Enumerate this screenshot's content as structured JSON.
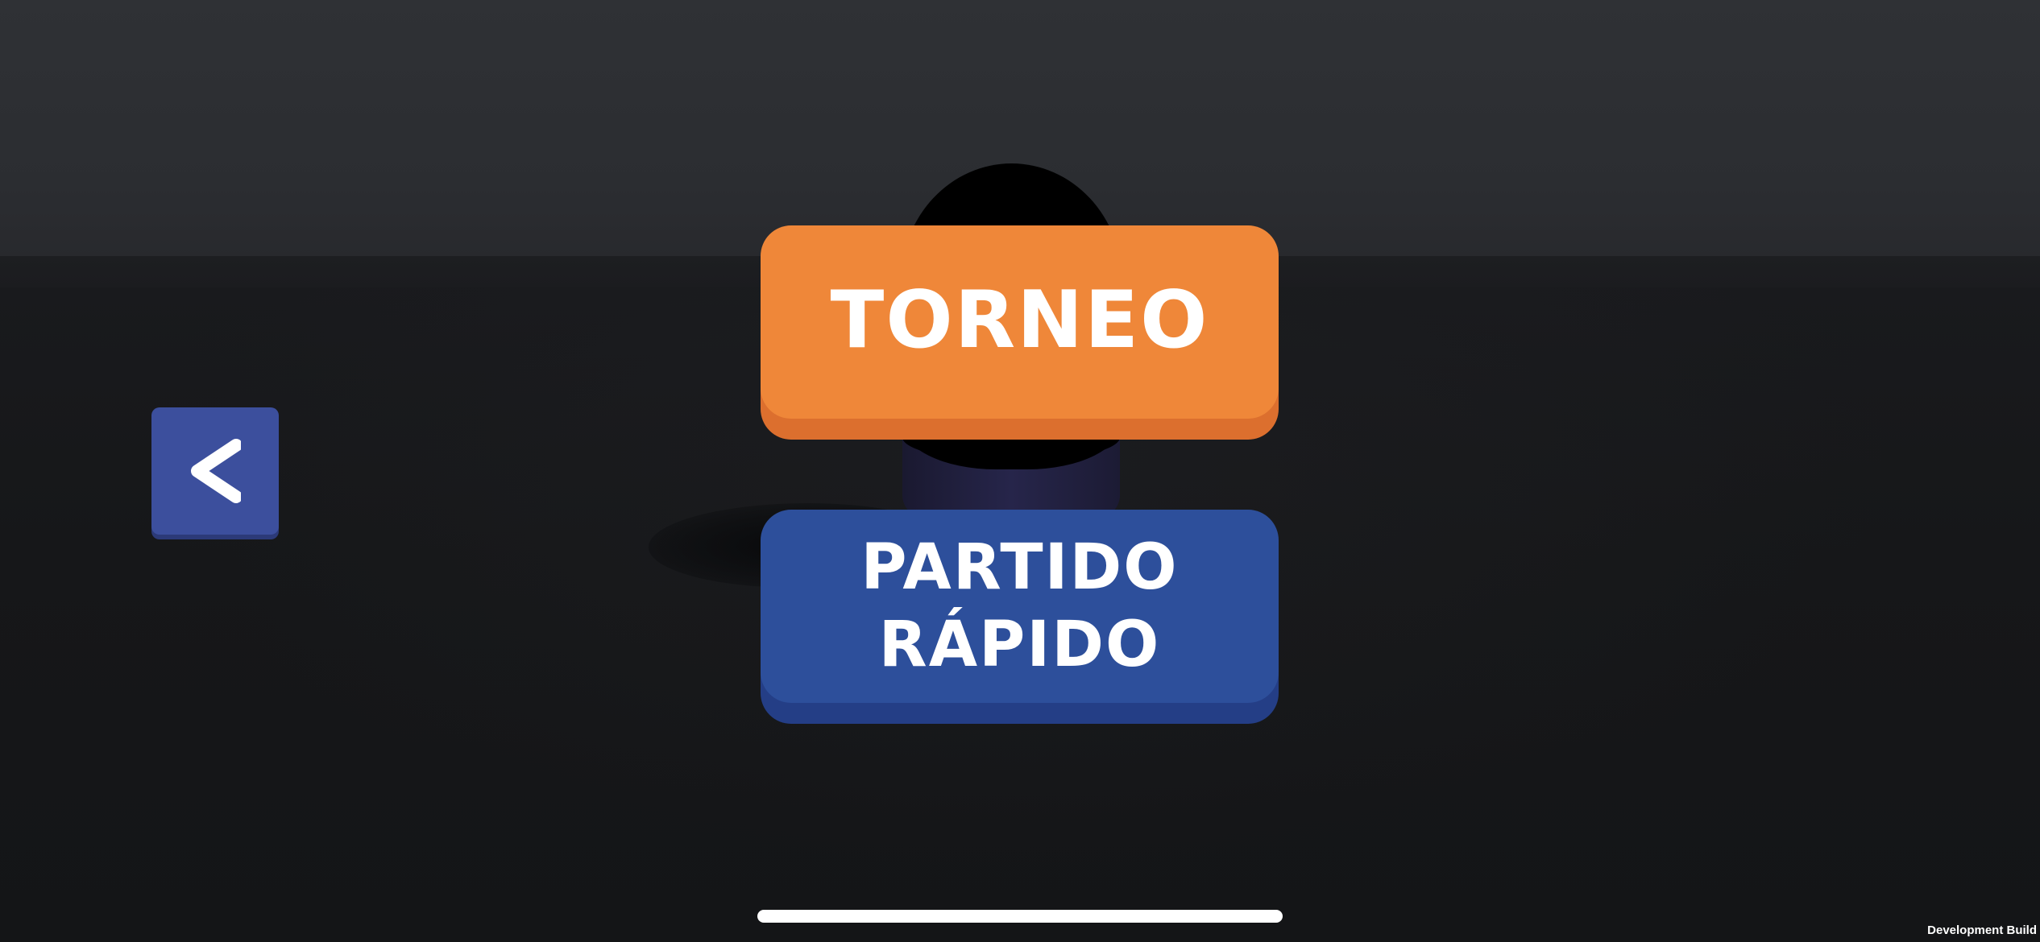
{
  "menu": {
    "tournament_label": "TORNEO",
    "quick_match_line1": "PARTIDO",
    "quick_match_line2": "RÁPIDO"
  },
  "navigation": {
    "back_icon": "chevron-left-icon"
  },
  "footer": {
    "build_label": "Development Build"
  },
  "colors": {
    "tournament_button": "#ef8739",
    "quick_match_button": "#2d4f9b",
    "back_button": "#3c4f9d",
    "background": "#151618"
  }
}
